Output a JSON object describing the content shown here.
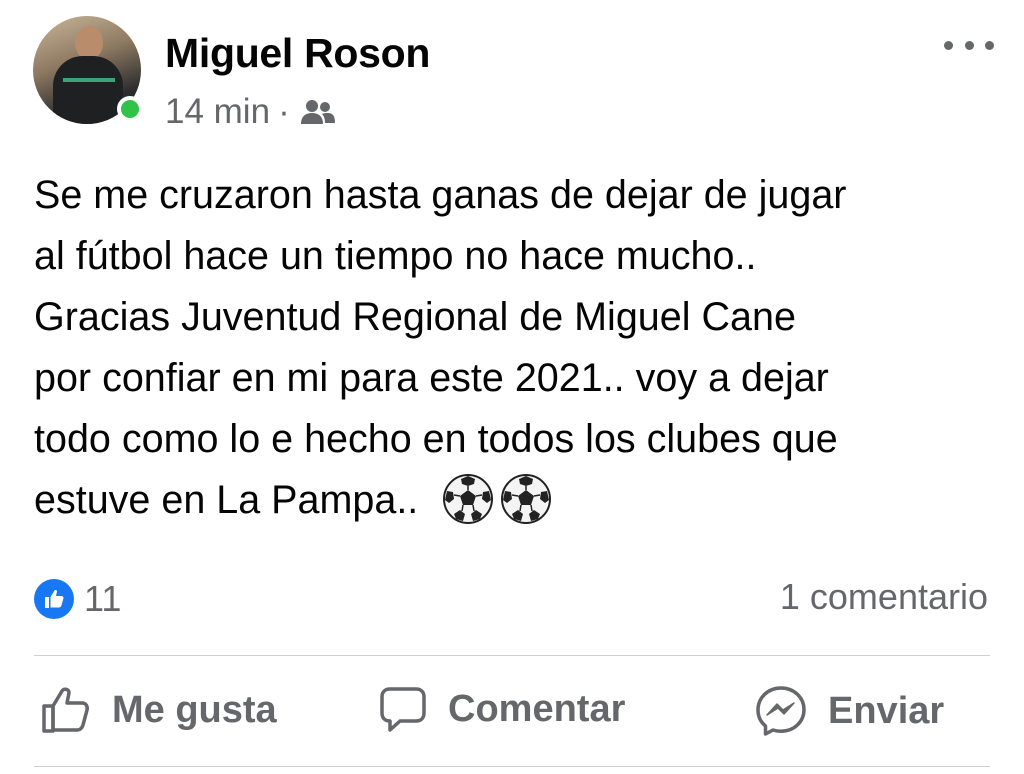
{
  "post": {
    "author": "Miguel Roson",
    "time": "14 min",
    "separator": "·",
    "audience_icon": "friends-icon",
    "online": true,
    "more_icon": "more-horizontal-icon",
    "text_lines": [
      "Se me cruzaron hasta ganas de dejar de jugar",
      "al fútbol hace un tiempo no hace mucho..",
      "Gracias Juventud Regional de Miguel Cane",
      "por confiar en mi para este 2021.. voy a dejar",
      "todo como lo e hecho en todos los clubes que",
      "estuve en La Pampa.."
    ],
    "emojis": [
      "⚽",
      "⚽"
    ]
  },
  "stats": {
    "reaction_icon": "like-reaction-icon",
    "reaction_count": "11",
    "comments": "1 comentario"
  },
  "actions": {
    "like_label": "Me gusta",
    "comment_label": "Comentar",
    "share_label": "Enviar"
  },
  "colors": {
    "accent": "#1877f2",
    "online": "#31c24a",
    "secondary_text": "#65676b",
    "divider": "#ced0d4"
  }
}
